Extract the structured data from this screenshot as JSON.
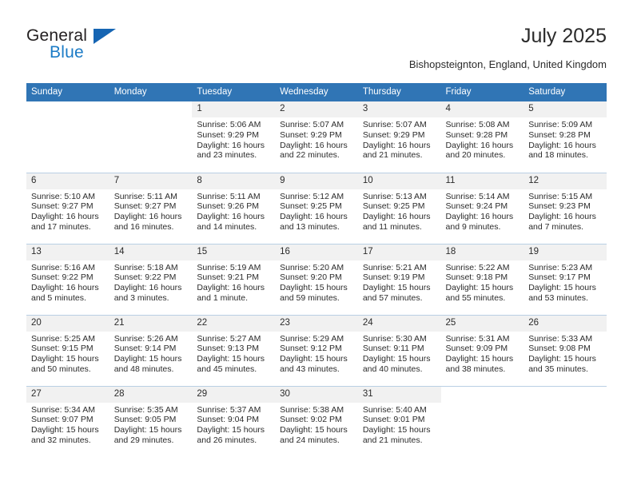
{
  "brand": {
    "name_top": "General",
    "name_bottom": "Blue",
    "triangle_icon": "blue-triangle-logo-mark",
    "accent_color": "#1b7bc6"
  },
  "header": {
    "title": "July 2025",
    "subtitle": "Bishopsteignton, England, United Kingdom"
  },
  "colors": {
    "header_row_bg": "#3075b5",
    "header_row_text": "#ffffff",
    "daynum_bg": "#f1f1f1",
    "row_border": "#b9cfe4",
    "body_text": "#2b2b2b"
  },
  "calendar": {
    "weekday_headers": [
      "Sunday",
      "Monday",
      "Tuesday",
      "Wednesday",
      "Thursday",
      "Friday",
      "Saturday"
    ],
    "labels": {
      "sunrise": "Sunrise:",
      "sunset": "Sunset:",
      "daylight": "Daylight:"
    },
    "weeks": [
      [
        {
          "day": "",
          "blank": true
        },
        {
          "day": "",
          "blank": true
        },
        {
          "day": "1",
          "sunrise": "Sunrise: 5:06 AM",
          "sunset": "Sunset: 9:29 PM",
          "daylight_line1": "Daylight: 16 hours",
          "daylight_line2": "and 23 minutes."
        },
        {
          "day": "2",
          "sunrise": "Sunrise: 5:07 AM",
          "sunset": "Sunset: 9:29 PM",
          "daylight_line1": "Daylight: 16 hours",
          "daylight_line2": "and 22 minutes."
        },
        {
          "day": "3",
          "sunrise": "Sunrise: 5:07 AM",
          "sunset": "Sunset: 9:29 PM",
          "daylight_line1": "Daylight: 16 hours",
          "daylight_line2": "and 21 minutes."
        },
        {
          "day": "4",
          "sunrise": "Sunrise: 5:08 AM",
          "sunset": "Sunset: 9:28 PM",
          "daylight_line1": "Daylight: 16 hours",
          "daylight_line2": "and 20 minutes."
        },
        {
          "day": "5",
          "sunrise": "Sunrise: 5:09 AM",
          "sunset": "Sunset: 9:28 PM",
          "daylight_line1": "Daylight: 16 hours",
          "daylight_line2": "and 18 minutes."
        }
      ],
      [
        {
          "day": "6",
          "sunrise": "Sunrise: 5:10 AM",
          "sunset": "Sunset: 9:27 PM",
          "daylight_line1": "Daylight: 16 hours",
          "daylight_line2": "and 17 minutes."
        },
        {
          "day": "7",
          "sunrise": "Sunrise: 5:11 AM",
          "sunset": "Sunset: 9:27 PM",
          "daylight_line1": "Daylight: 16 hours",
          "daylight_line2": "and 16 minutes."
        },
        {
          "day": "8",
          "sunrise": "Sunrise: 5:11 AM",
          "sunset": "Sunset: 9:26 PM",
          "daylight_line1": "Daylight: 16 hours",
          "daylight_line2": "and 14 minutes."
        },
        {
          "day": "9",
          "sunrise": "Sunrise: 5:12 AM",
          "sunset": "Sunset: 9:25 PM",
          "daylight_line1": "Daylight: 16 hours",
          "daylight_line2": "and 13 minutes."
        },
        {
          "day": "10",
          "sunrise": "Sunrise: 5:13 AM",
          "sunset": "Sunset: 9:25 PM",
          "daylight_line1": "Daylight: 16 hours",
          "daylight_line2": "and 11 minutes."
        },
        {
          "day": "11",
          "sunrise": "Sunrise: 5:14 AM",
          "sunset": "Sunset: 9:24 PM",
          "daylight_line1": "Daylight: 16 hours",
          "daylight_line2": "and 9 minutes."
        },
        {
          "day": "12",
          "sunrise": "Sunrise: 5:15 AM",
          "sunset": "Sunset: 9:23 PM",
          "daylight_line1": "Daylight: 16 hours",
          "daylight_line2": "and 7 minutes."
        }
      ],
      [
        {
          "day": "13",
          "sunrise": "Sunrise: 5:16 AM",
          "sunset": "Sunset: 9:22 PM",
          "daylight_line1": "Daylight: 16 hours",
          "daylight_line2": "and 5 minutes."
        },
        {
          "day": "14",
          "sunrise": "Sunrise: 5:18 AM",
          "sunset": "Sunset: 9:22 PM",
          "daylight_line1": "Daylight: 16 hours",
          "daylight_line2": "and 3 minutes."
        },
        {
          "day": "15",
          "sunrise": "Sunrise: 5:19 AM",
          "sunset": "Sunset: 9:21 PM",
          "daylight_line1": "Daylight: 16 hours",
          "daylight_line2": "and 1 minute."
        },
        {
          "day": "16",
          "sunrise": "Sunrise: 5:20 AM",
          "sunset": "Sunset: 9:20 PM",
          "daylight_line1": "Daylight: 15 hours",
          "daylight_line2": "and 59 minutes."
        },
        {
          "day": "17",
          "sunrise": "Sunrise: 5:21 AM",
          "sunset": "Sunset: 9:19 PM",
          "daylight_line1": "Daylight: 15 hours",
          "daylight_line2": "and 57 minutes."
        },
        {
          "day": "18",
          "sunrise": "Sunrise: 5:22 AM",
          "sunset": "Sunset: 9:18 PM",
          "daylight_line1": "Daylight: 15 hours",
          "daylight_line2": "and 55 minutes."
        },
        {
          "day": "19",
          "sunrise": "Sunrise: 5:23 AM",
          "sunset": "Sunset: 9:17 PM",
          "daylight_line1": "Daylight: 15 hours",
          "daylight_line2": "and 53 minutes."
        }
      ],
      [
        {
          "day": "20",
          "sunrise": "Sunrise: 5:25 AM",
          "sunset": "Sunset: 9:15 PM",
          "daylight_line1": "Daylight: 15 hours",
          "daylight_line2": "and 50 minutes."
        },
        {
          "day": "21",
          "sunrise": "Sunrise: 5:26 AM",
          "sunset": "Sunset: 9:14 PM",
          "daylight_line1": "Daylight: 15 hours",
          "daylight_line2": "and 48 minutes."
        },
        {
          "day": "22",
          "sunrise": "Sunrise: 5:27 AM",
          "sunset": "Sunset: 9:13 PM",
          "daylight_line1": "Daylight: 15 hours",
          "daylight_line2": "and 45 minutes."
        },
        {
          "day": "23",
          "sunrise": "Sunrise: 5:29 AM",
          "sunset": "Sunset: 9:12 PM",
          "daylight_line1": "Daylight: 15 hours",
          "daylight_line2": "and 43 minutes."
        },
        {
          "day": "24",
          "sunrise": "Sunrise: 5:30 AM",
          "sunset": "Sunset: 9:11 PM",
          "daylight_line1": "Daylight: 15 hours",
          "daylight_line2": "and 40 minutes."
        },
        {
          "day": "25",
          "sunrise": "Sunrise: 5:31 AM",
          "sunset": "Sunset: 9:09 PM",
          "daylight_line1": "Daylight: 15 hours",
          "daylight_line2": "and 38 minutes."
        },
        {
          "day": "26",
          "sunrise": "Sunrise: 5:33 AM",
          "sunset": "Sunset: 9:08 PM",
          "daylight_line1": "Daylight: 15 hours",
          "daylight_line2": "and 35 minutes."
        }
      ],
      [
        {
          "day": "27",
          "sunrise": "Sunrise: 5:34 AM",
          "sunset": "Sunset: 9:07 PM",
          "daylight_line1": "Daylight: 15 hours",
          "daylight_line2": "and 32 minutes."
        },
        {
          "day": "28",
          "sunrise": "Sunrise: 5:35 AM",
          "sunset": "Sunset: 9:05 PM",
          "daylight_line1": "Daylight: 15 hours",
          "daylight_line2": "and 29 minutes."
        },
        {
          "day": "29",
          "sunrise": "Sunrise: 5:37 AM",
          "sunset": "Sunset: 9:04 PM",
          "daylight_line1": "Daylight: 15 hours",
          "daylight_line2": "and 26 minutes."
        },
        {
          "day": "30",
          "sunrise": "Sunrise: 5:38 AM",
          "sunset": "Sunset: 9:02 PM",
          "daylight_line1": "Daylight: 15 hours",
          "daylight_line2": "and 24 minutes."
        },
        {
          "day": "31",
          "sunrise": "Sunrise: 5:40 AM",
          "sunset": "Sunset: 9:01 PM",
          "daylight_line1": "Daylight: 15 hours",
          "daylight_line2": "and 21 minutes."
        },
        {
          "day": "",
          "blank": true
        },
        {
          "day": "",
          "blank": true
        }
      ]
    ]
  }
}
